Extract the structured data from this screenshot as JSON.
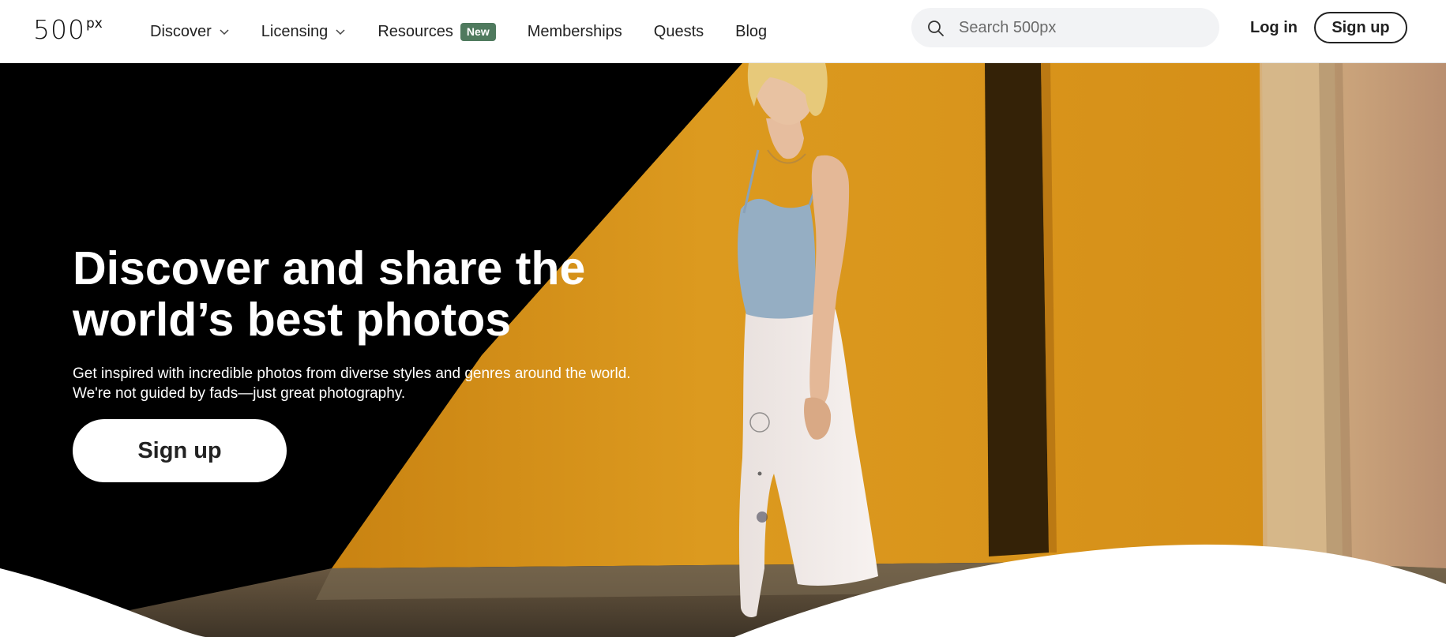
{
  "brand": {
    "logo_main": "500",
    "logo_sup": "px"
  },
  "nav": {
    "items": [
      {
        "label": "Discover",
        "has_dropdown": true
      },
      {
        "label": "Licensing",
        "has_dropdown": true
      },
      {
        "label": "Resources",
        "badge": "New"
      },
      {
        "label": "Memberships"
      },
      {
        "label": "Quests"
      },
      {
        "label": "Blog"
      }
    ]
  },
  "search": {
    "placeholder": "Search 500px",
    "value": ""
  },
  "auth": {
    "login_label": "Log in",
    "signup_label": "Sign up"
  },
  "hero": {
    "title_line1": "Discover and share the",
    "title_line2": "world’s best photos",
    "subtitle": "Get inspired with incredible photos from diverse styles and genres around the world. We're not guided by fads—just great photography.",
    "cta_label": "Sign up"
  },
  "colors": {
    "badge_new": "#4f7a5e",
    "hero_wall": "#d8941c",
    "hero_dark": "#000000"
  }
}
